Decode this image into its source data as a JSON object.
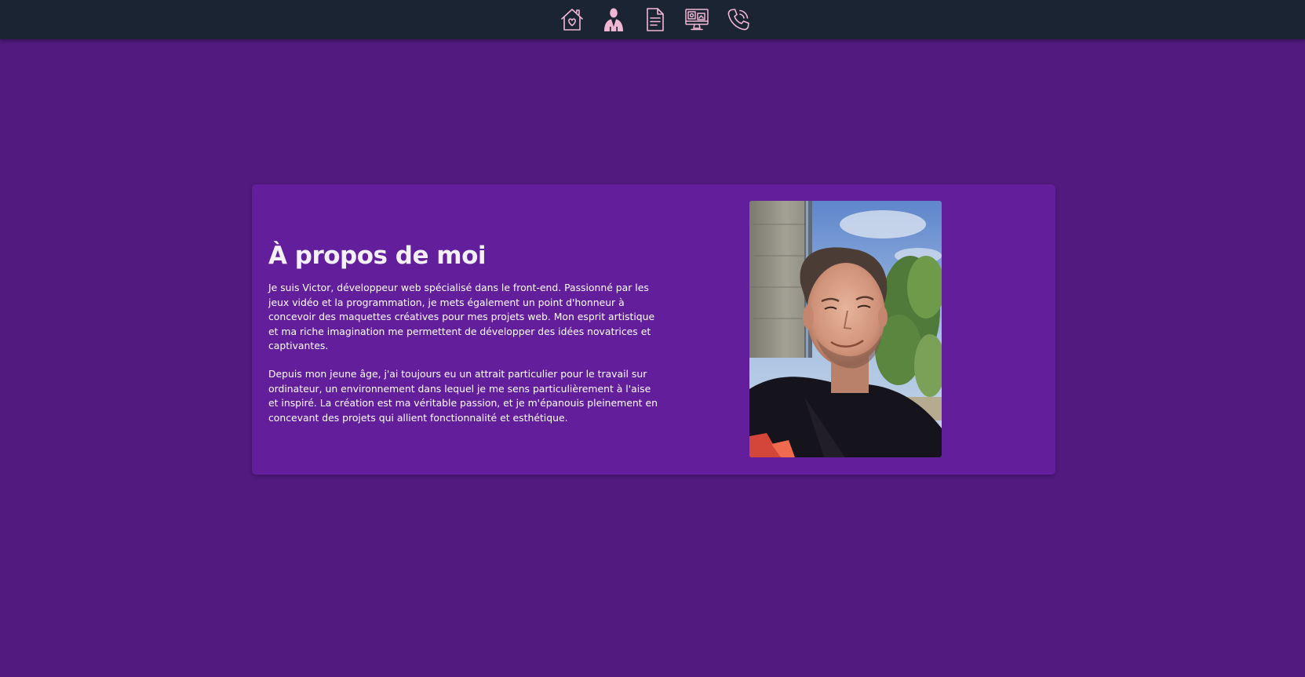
{
  "nav": {
    "items": [
      {
        "icon": "home-heart-icon"
      },
      {
        "icon": "person-suit-icon"
      },
      {
        "icon": "document-icon"
      },
      {
        "icon": "monitor-icon"
      },
      {
        "icon": "phone-icon"
      }
    ],
    "icon_color": "#f0b7d4"
  },
  "about": {
    "title": "À propos de moi",
    "paragraph_1": "Je suis Victor, développeur web spécialisé dans le front-end. Passionné par les jeux vidéo et la programmation, je mets également un point d'honneur à concevoir des maquettes créatives pour mes projets web. Mon esprit artistique et ma riche imagination me permettent de développer des idées novatrices et captivantes.",
    "paragraph_2": "Depuis mon jeune âge, j'ai toujours eu un attrait particulier pour le travail sur ordinateur, un environnement dans lequel je me sens particulièrement à l'aise et inspiré. La création est ma véritable passion, et je m'épanouis pleinement en concevant des projets qui allient fonctionnalité et esthétique."
  },
  "colors": {
    "background": "#521a7f",
    "card": "#621e9b",
    "topbar": "#1b2432"
  }
}
